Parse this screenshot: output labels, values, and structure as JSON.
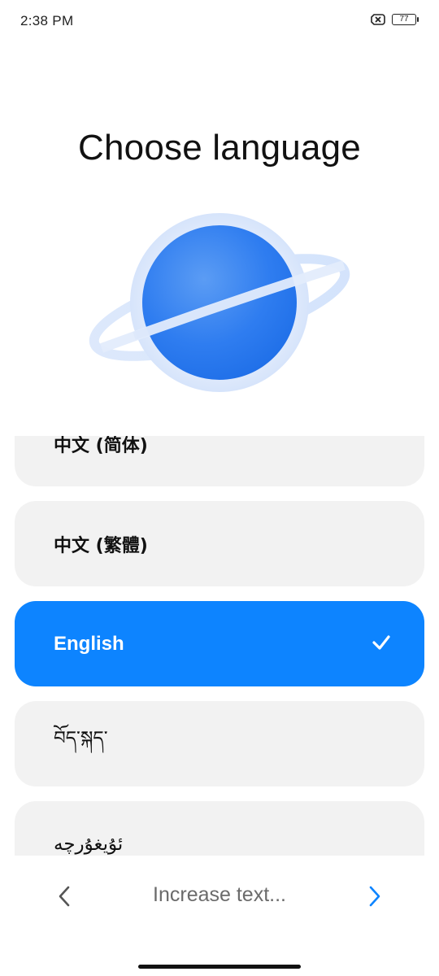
{
  "status_bar": {
    "time": "2:38 PM",
    "battery_level": "77",
    "icons": [
      "sim-off-icon",
      "battery-icon"
    ]
  },
  "title": "Choose language",
  "illustration": "planet-icon",
  "languages": [
    {
      "label": "中文 (简体)",
      "selected": false
    },
    {
      "label": "中文 (繁體)",
      "selected": false
    },
    {
      "label": "English",
      "selected": true
    },
    {
      "label": "བོད་སྐད་",
      "selected": false
    },
    {
      "label": "ئۇيغۇرچە",
      "selected": false
    }
  ],
  "bottom_nav": {
    "label": "Increase text...",
    "back_icon": "chevron-left-icon",
    "next_icon": "chevron-right-icon"
  },
  "colors": {
    "accent": "#0d84ff",
    "item_bg": "#f2f2f2",
    "text": "#111111",
    "muted": "#6b6b6b"
  }
}
